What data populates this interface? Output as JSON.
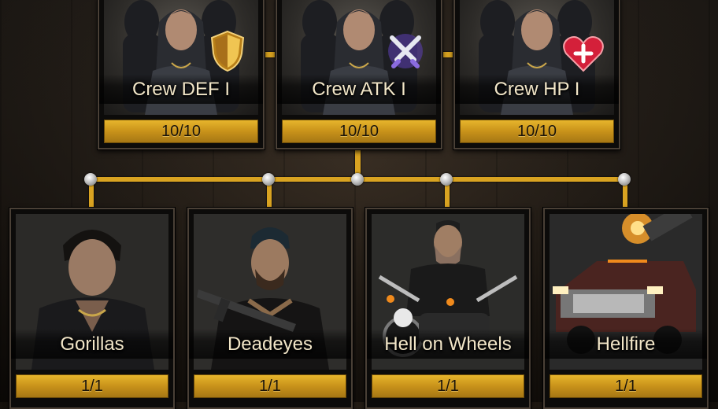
{
  "skills_top": [
    {
      "name": "Crew DEF I",
      "progress": "10/10",
      "badge": "shield-badge-icon",
      "badge_color": "#d8a531"
    },
    {
      "name": "Crew ATK I",
      "progress": "10/10",
      "badge": "crossed-swords-badge-icon",
      "badge_color": "#7a5ed0"
    },
    {
      "name": "Crew HP I",
      "progress": "10/10",
      "badge": "heart-plus-badge-icon",
      "badge_color": "#d4203a"
    }
  ],
  "units": [
    {
      "name": "Gorillas",
      "progress": "1/1"
    },
    {
      "name": "Deadeyes",
      "progress": "1/1"
    },
    {
      "name": "Hell on Wheels",
      "progress": "1/1"
    },
    {
      "name": "Hellfire",
      "progress": "1/1"
    }
  ],
  "colors": {
    "accent_gold": "#d9a321",
    "progress_bar": "#d39c20",
    "label_text": "#f2e6c8"
  }
}
